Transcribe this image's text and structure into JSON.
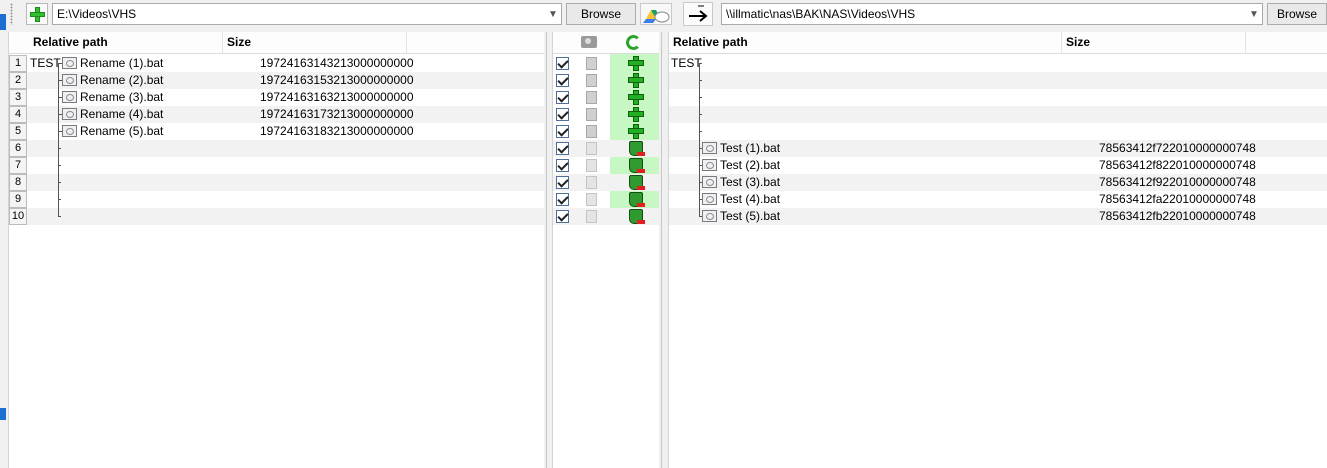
{
  "left": {
    "path_value": "E:\\Videos\\VHS",
    "browse_label": "Browse",
    "columns": [
      "Relative path",
      "Size"
    ],
    "root_folder": "TEST",
    "rows": [
      {
        "num": "1",
        "name": "Rename (1).bat",
        "size": "19724163143213000000000"
      },
      {
        "num": "2",
        "name": "Rename (2).bat",
        "size": "19724163153213000000000"
      },
      {
        "num": "3",
        "name": "Rename (3).bat",
        "size": "19724163163213000000000"
      },
      {
        "num": "4",
        "name": "Rename (4).bat",
        "size": "19724163173213000000000"
      },
      {
        "num": "5",
        "name": "Rename (5).bat",
        "size": "19724163183213000000000"
      },
      {
        "num": "6",
        "name": "",
        "size": ""
      },
      {
        "num": "7",
        "name": "",
        "size": ""
      },
      {
        "num": "8",
        "name": "",
        "size": ""
      },
      {
        "num": "9",
        "name": "",
        "size": ""
      },
      {
        "num": "10",
        "name": "",
        "size": ""
      }
    ]
  },
  "middle": {
    "icons": [
      "camera-icon",
      "sync-icon"
    ],
    "rows": [
      {
        "checked": true,
        "action": "create-right-icon"
      },
      {
        "checked": true,
        "action": "create-right-icon"
      },
      {
        "checked": true,
        "action": "create-right-icon"
      },
      {
        "checked": true,
        "action": "create-right-icon"
      },
      {
        "checked": true,
        "action": "create-right-icon"
      },
      {
        "checked": true,
        "action": "delete-right-icon"
      },
      {
        "checked": true,
        "action": "delete-right-icon"
      },
      {
        "checked": true,
        "action": "delete-right-icon"
      },
      {
        "checked": true,
        "action": "delete-right-icon"
      },
      {
        "checked": true,
        "action": "delete-right-icon"
      }
    ],
    "colors": {
      "action_bg": "#c7f7c2",
      "create": "#21b021",
      "delete_mark": "#e02020"
    }
  },
  "right": {
    "path_value": "\\\\illmatic\\nas\\BAK\\NAS\\Videos\\VHS",
    "browse_label": "Browse",
    "columns": [
      "Relative path",
      "Size"
    ],
    "root_folder": "TEST",
    "rows": [
      {
        "name": "",
        "size": ""
      },
      {
        "name": "",
        "size": ""
      },
      {
        "name": "",
        "size": ""
      },
      {
        "name": "",
        "size": ""
      },
      {
        "name": "",
        "size": ""
      },
      {
        "name": "Test (1).bat",
        "size": "78563412f722010000000748"
      },
      {
        "name": "Test (2).bat",
        "size": "78563412f822010000000748"
      },
      {
        "name": "Test (3).bat",
        "size": "78563412f922010000000748"
      },
      {
        "name": "Test (4).bat",
        "size": "78563412fa22010000000748"
      },
      {
        "name": "Test (5).bat",
        "size": "78563412fb22010000000748"
      }
    ]
  }
}
